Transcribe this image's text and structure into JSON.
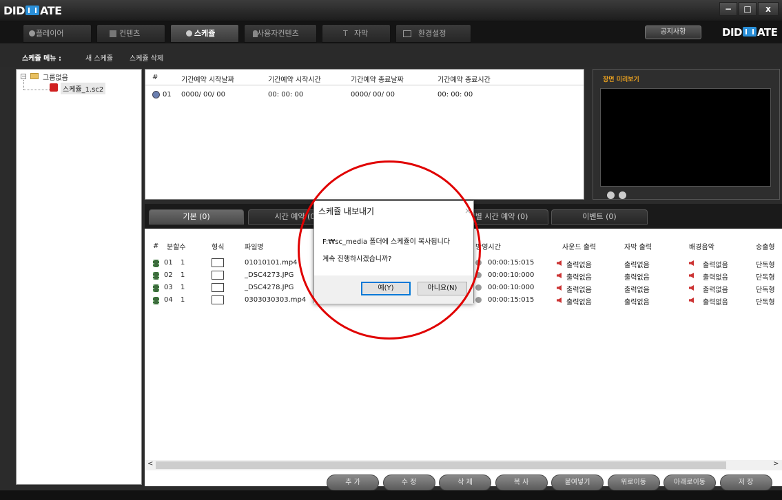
{
  "app": {
    "logo_left": "DIDMATE",
    "logo_right": "DIDMATE",
    "window_buttons": [
      "−",
      "□",
      "x"
    ]
  },
  "main_tabs": [
    {
      "label": "플레이어",
      "icon": "play-icon"
    },
    {
      "label": "컨텐츠",
      "icon": "film-icon"
    },
    {
      "label": "스케쥴",
      "icon": "clock-icon",
      "active": true
    },
    {
      "label": "사용자컨텐츠",
      "icon": "user-icon"
    },
    {
      "label": "자막",
      "icon": "text-icon"
    },
    {
      "label": "환경설정",
      "icon": "settings-icon"
    }
  ],
  "notice_button": "공지사항",
  "schedule_menu": {
    "label": "스케쥴 메뉴 :",
    "new": "새 스케쥴",
    "delete": "스케쥴 삭제"
  },
  "tree": {
    "root": "그룹없음",
    "child": "스케쥴_1.sc2"
  },
  "schedule_table": {
    "headers": [
      "#",
      "기간예약 시작날짜",
      "기간예약 시작시간",
      "기간예약 종료날짜",
      "기간예약 종료시간"
    ],
    "row": {
      "num": "01",
      "start_date": "0000/ 00/ 00",
      "start_time": "00: 00: 00",
      "end_date": "0000/ 00/ 00",
      "end_time": "00: 00: 00"
    }
  },
  "preview": {
    "title": "장면 미리보기"
  },
  "sub_tabs": [
    "기본 (0)",
    "시간 예약 (0)",
    "일별 시간 예약 (0)",
    "이벤트 (0)"
  ],
  "file_table": {
    "headers": [
      "#",
      "분할수",
      "형식",
      "파일명",
      "방영시간",
      "사운드 출력",
      "자막 출력",
      "배경음악",
      "송출형"
    ],
    "rows": [
      {
        "num": "01",
        "split": "1",
        "file": "01010101.mp4",
        "duration": "00:00:15:015",
        "sound": "출력없음",
        "subtitle": "출력없음",
        "bgm": "출력없음",
        "mode": "단독형"
      },
      {
        "num": "02",
        "split": "1",
        "file": "_DSC4273.JPG",
        "duration": "00:00:10:000",
        "sound": "출력없음",
        "subtitle": "출력없음",
        "bgm": "출력없음",
        "mode": "단독형"
      },
      {
        "num": "03",
        "split": "1",
        "file": "_DSC4278.JPG",
        "duration": "00:00:10:000",
        "sound": "출력없음",
        "subtitle": "출력없음",
        "bgm": "출력없음",
        "mode": "단독형"
      },
      {
        "num": "04",
        "split": "1",
        "file": "0303030303.mp4",
        "duration": "00:00:15:015",
        "sound": "출력없음",
        "subtitle": "출력없음",
        "bgm": "출력없음",
        "mode": "단독형"
      }
    ]
  },
  "bottom_buttons": [
    "추 가",
    "수 정",
    "삭 제",
    "복 사",
    "붙여넣기",
    "위로이동",
    "아래로이동",
    "저 장"
  ],
  "dialog": {
    "title": "스케쥴 내보내기",
    "line1": "F:₩sc_media 폴더에 스케쥴이 복사됩니다",
    "line2": "계속 진행하시겠습니까?",
    "yes": "예(Y)",
    "no": "아니요(N)"
  },
  "colors": {
    "accent_orange": "#e8a020",
    "highlight_red": "#e00000",
    "logo_blue": "#2a8fd8"
  }
}
